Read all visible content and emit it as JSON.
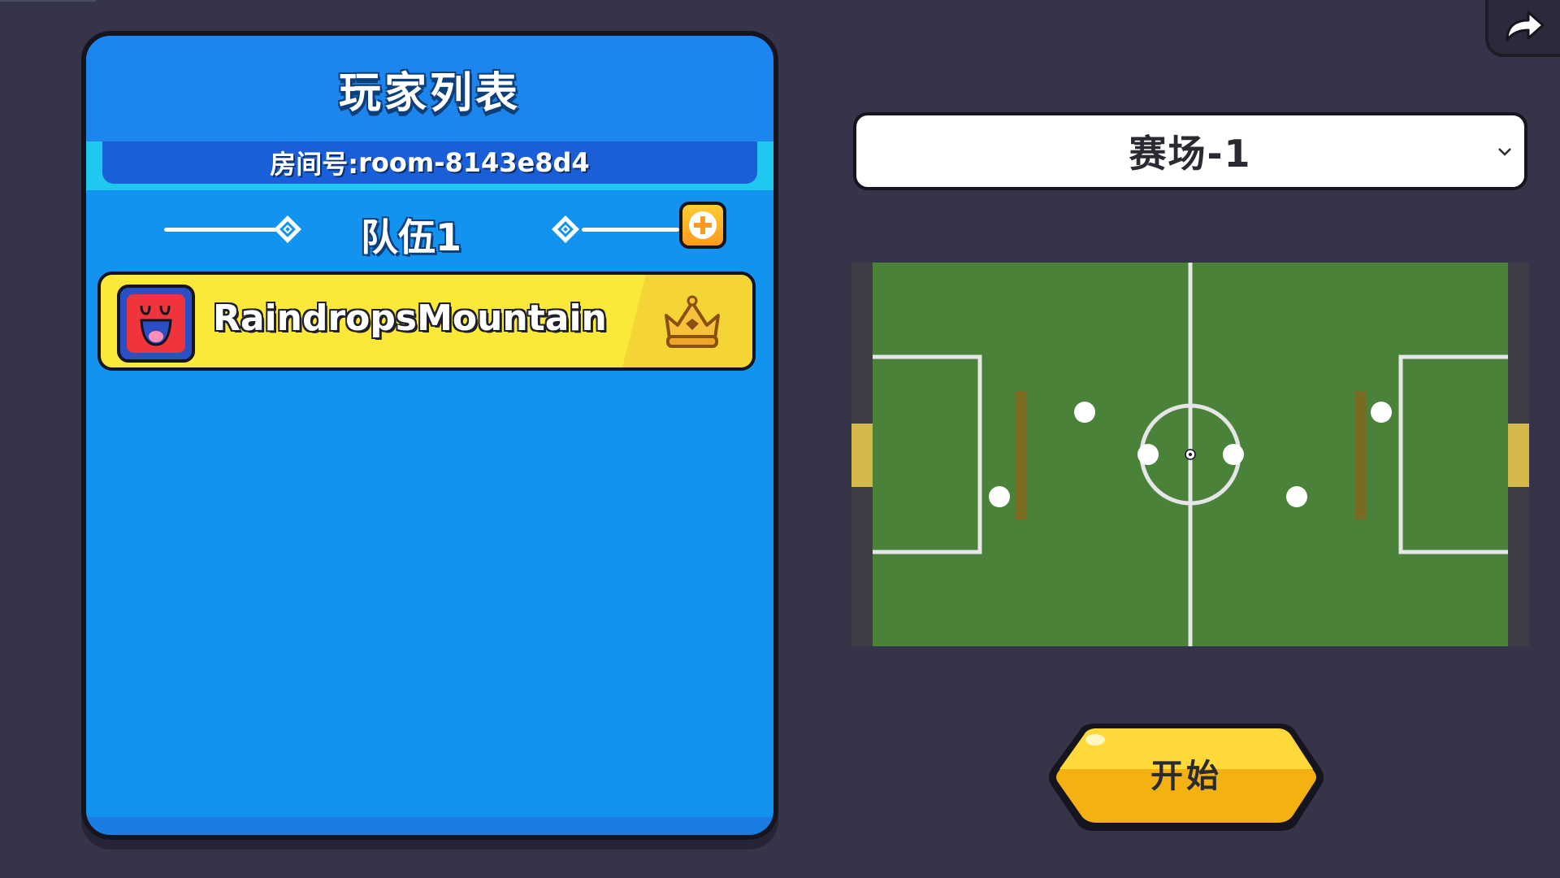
{
  "panel": {
    "title": "玩家列表",
    "room_label": "房间号:",
    "room_id": "room-8143e8d4",
    "team_name": "队伍1",
    "players": [
      {
        "name": "RaindropsMountain",
        "is_host": true,
        "avatar_color": "#f0343c"
      }
    ]
  },
  "arena": {
    "selected": "赛场-1"
  },
  "start_button": {
    "label": "开始"
  },
  "icons": {
    "exit": "exit-arrow-icon",
    "add": "plus-icon",
    "crown": "crown-icon",
    "chevron": "chevron-down-icon"
  },
  "colors": {
    "background": "#353449",
    "panel_blue": "#1293f0",
    "player_card": "#fbe93a",
    "field_green": "#4a823a",
    "start_yellow": "#ffd21f"
  }
}
